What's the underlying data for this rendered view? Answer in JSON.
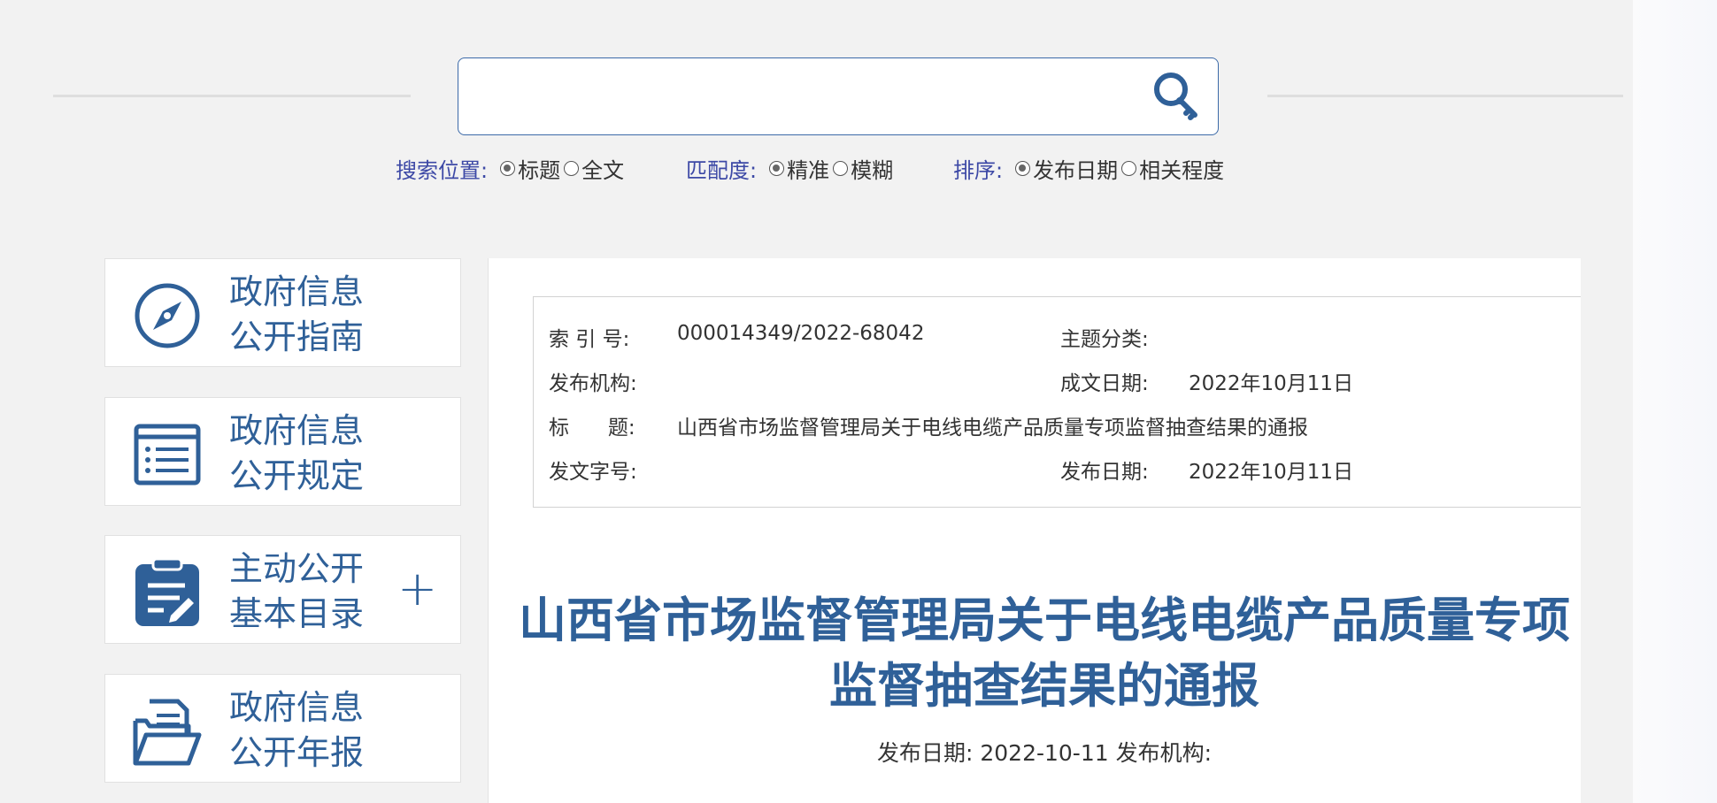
{
  "search": {
    "value": "",
    "placeholder": ""
  },
  "options": {
    "position_label": "搜索位置:",
    "position_opts": [
      "标题",
      "全文"
    ],
    "match_label": "匹配度:",
    "match_opts": [
      "精准",
      "模糊"
    ],
    "sort_label": "排序:",
    "sort_opts": [
      "发布日期",
      "相关程度"
    ]
  },
  "sidebar": {
    "items": [
      {
        "line1": "政府信息",
        "line2": "公开指南",
        "icon": "compass-icon"
      },
      {
        "line1": "政府信息",
        "line2": "公开规定",
        "icon": "list-document-icon"
      },
      {
        "line1": "主动公开",
        "line2": "基本目录",
        "icon": "clipboard-edit-icon",
        "expand": "+"
      },
      {
        "line1": "政府信息",
        "line2": "公开年报",
        "icon": "folder-document-icon"
      }
    ]
  },
  "meta": {
    "index_label": "索  引 号:",
    "index_value": "000014349/2022-68042",
    "topic_label": "主题分类:",
    "topic_value": "",
    "org_label": "发布机构:",
    "org_value": "",
    "created_label": "成文日期:",
    "created_value": "2022年10月11日",
    "title_label": "标      题:",
    "title_value": "山西省市场监督管理局关于电线电缆产品质量专项监督抽查结果的通报",
    "docno_label": "发文字号:",
    "docno_value": "",
    "published_label": "发布日期:",
    "published_value": "2022年10月11日"
  },
  "document": {
    "title_line1": "山西省市场监督管理局关于电线电缆产品质量专项",
    "title_line2": "监督抽查结果的通报",
    "subline": "发布日期: 2022-10-11 发布机构:"
  },
  "colors": {
    "brand": "#2f6098",
    "label": "#3d49a6",
    "search_border": "#3c6aa8"
  }
}
